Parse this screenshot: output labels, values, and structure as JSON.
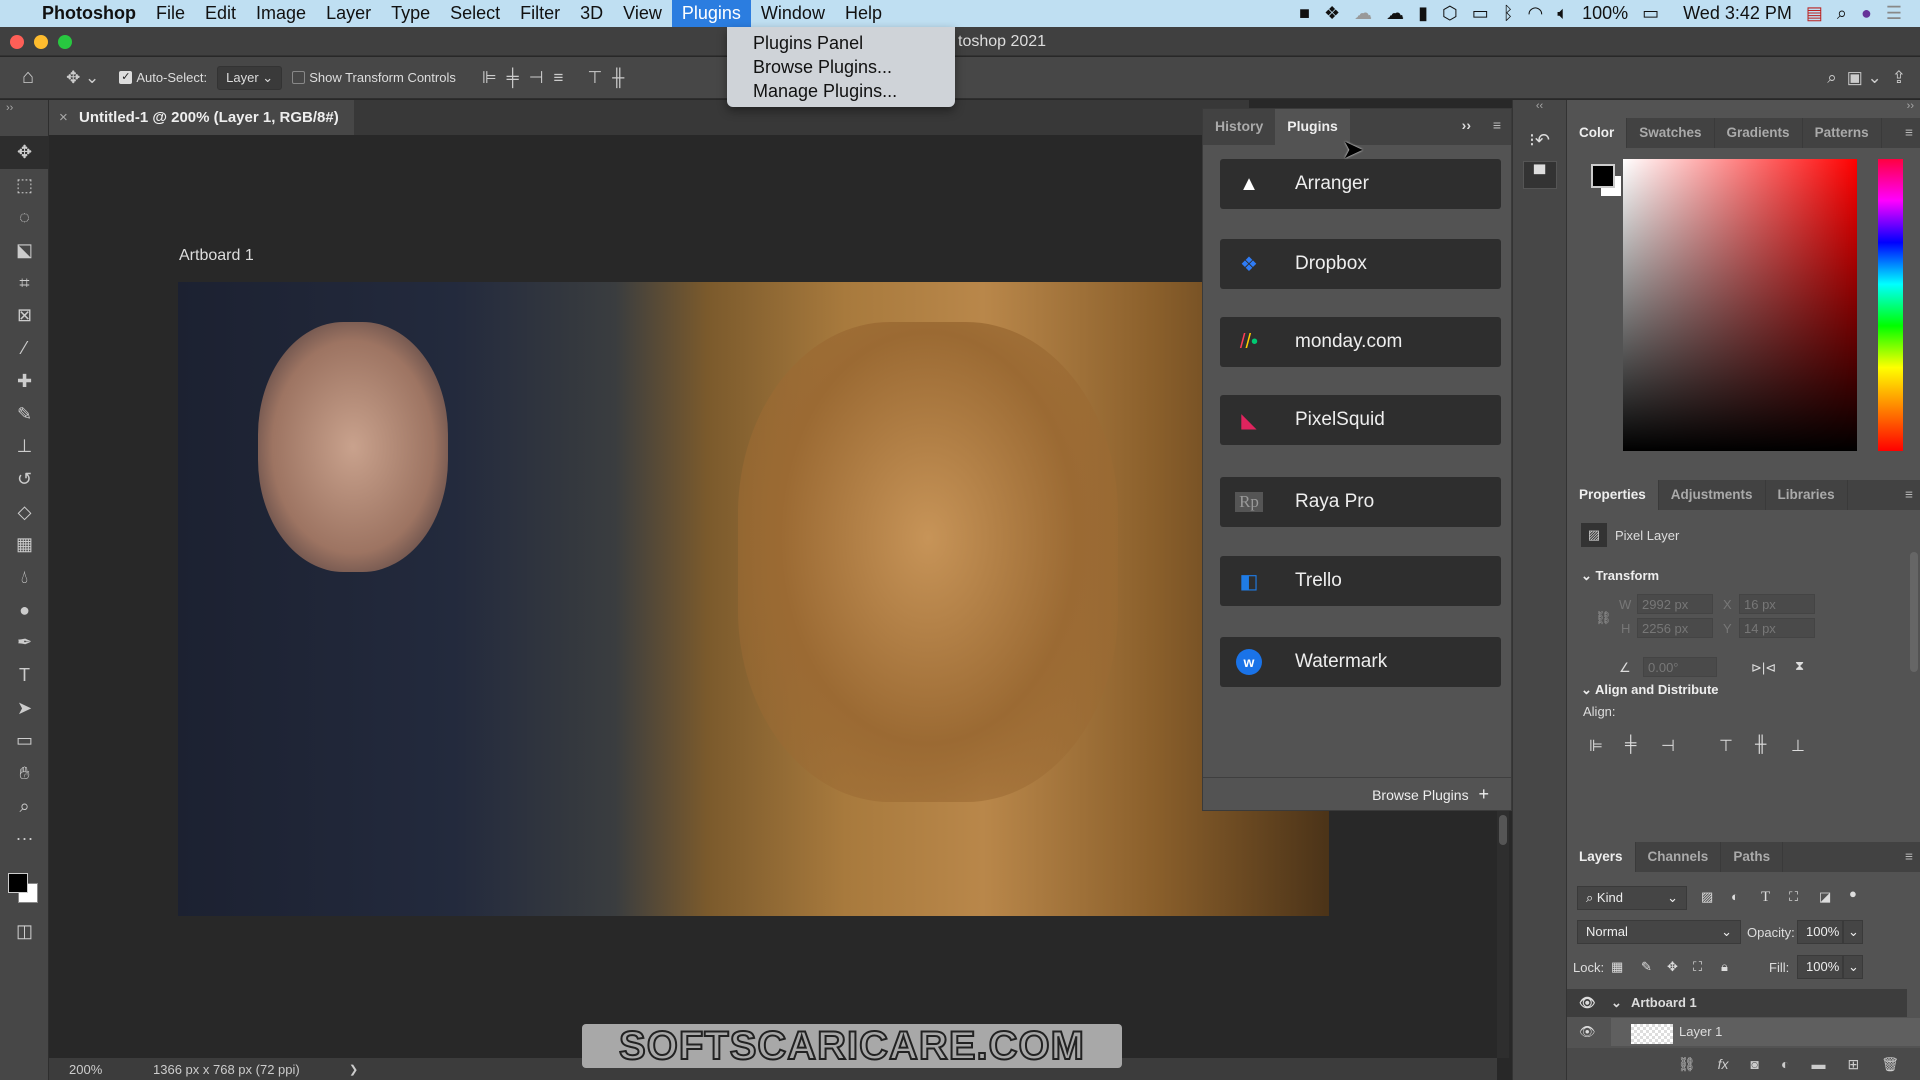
{
  "menubar": {
    "app": "Photoshop",
    "items": [
      "File",
      "Edit",
      "Image",
      "Layer",
      "Type",
      "Select",
      "Filter",
      "3D",
      "View",
      "Plugins",
      "Window",
      "Help"
    ],
    "active": "Plugins",
    "battery": "100%",
    "clock": "Wed 3:42 PM"
  },
  "plugins_menu": {
    "items": [
      "Plugins Panel",
      "Browse Plugins...",
      "Manage Plugins..."
    ]
  },
  "window": {
    "title_fragment": "toshop 2021"
  },
  "options": {
    "auto_select_label": "Auto-Select:",
    "auto_select_checked": true,
    "auto_select_value": "Layer",
    "show_transform_label": "Show Transform Controls",
    "show_transform_checked": false
  },
  "document": {
    "tab": "Untitled-1 @ 200% (Layer 1, RGB/8#)",
    "artboard_label": "Artboard 1"
  },
  "status": {
    "zoom": "200%",
    "info": "1366 px x 768 px (72 ppi)",
    "arrow": "❯"
  },
  "plugins_panel": {
    "tabs": [
      "History",
      "Plugins"
    ],
    "active": "Plugins",
    "items": [
      {
        "label": "Arranger",
        "icon": "arranger-icon",
        "color": "#ffffff"
      },
      {
        "label": "Dropbox",
        "icon": "dropbox-icon",
        "color": "#2f7cf6"
      },
      {
        "label": "monday.com",
        "icon": "monday-icon",
        "color": "#ff3d57"
      },
      {
        "label": "PixelSquid",
        "icon": "pixelsquid-icon",
        "color": "#e0245e"
      },
      {
        "label": "Raya Pro",
        "icon": "raya-pro-icon",
        "color": "#888888"
      },
      {
        "label": "Trello",
        "icon": "trello-icon",
        "color": "#1f7ce6"
      },
      {
        "label": "Watermark",
        "icon": "watermark-icon",
        "color": "#1a73e8"
      }
    ],
    "footer": "Browse Plugins"
  },
  "color_panel": {
    "tabs": [
      "Color",
      "Swatches",
      "Gradients",
      "Patterns"
    ],
    "active": "Color",
    "hue_color": "#ff0000"
  },
  "properties": {
    "tabs": [
      "Properties",
      "Adjustments",
      "Libraries"
    ],
    "active": "Properties",
    "kind": "Pixel Layer",
    "transform_header": "Transform",
    "w_label": "W",
    "w": "2992 px",
    "h_label": "H",
    "h": "2256 px",
    "x_label": "X",
    "x": "16 px",
    "y_label": "Y",
    "y": "14 px",
    "angle": "0.00°",
    "align_header": "Align and Distribute",
    "align_label": "Align:"
  },
  "layers": {
    "tabs": [
      "Layers",
      "Channels",
      "Paths"
    ],
    "active": "Layers",
    "filter": "Kind",
    "blend": "Normal",
    "opacity_label": "Opacity:",
    "opacity": "100%",
    "lock_label": "Lock:",
    "fill_label": "Fill:",
    "fill": "100%",
    "rows": [
      {
        "name": "Artboard 1"
      },
      {
        "name": "Layer 1"
      }
    ]
  },
  "watermark": {
    "text": "SOFTSCARICARE.COM"
  }
}
